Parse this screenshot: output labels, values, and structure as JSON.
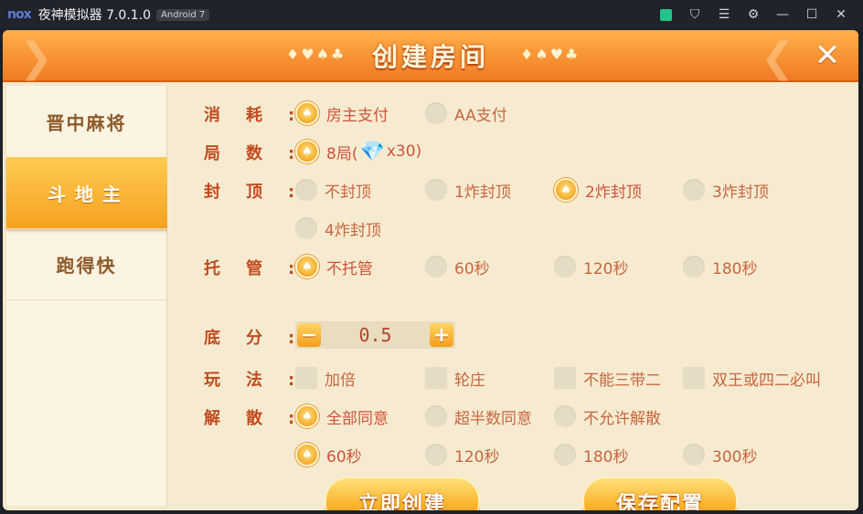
{
  "window": {
    "logo": "nox",
    "title": "夜神模拟器 7.0.1.0",
    "badge": "Android 7"
  },
  "header": {
    "title": "创建房间",
    "deco_left": "♦♥♠♣",
    "deco_right": "♦♠♥♣"
  },
  "sidebar": {
    "items": [
      {
        "label": "晋中麻将"
      },
      {
        "label": "斗地主"
      },
      {
        "label": "跑得快"
      }
    ]
  },
  "rows": {
    "consume": {
      "label": "消耗:",
      "options": [
        "房主支付",
        "AA支付"
      ]
    },
    "rounds": {
      "label": "局数:",
      "option_prefix": "8局(",
      "option_suffix": "x30)"
    },
    "cap": {
      "label": "封顶:",
      "options": [
        "不封顶",
        "1炸封顶",
        "2炸封顶",
        "3炸封顶",
        "4炸封顶"
      ]
    },
    "auto": {
      "label": "托管:",
      "options": [
        "不托管",
        "60秒",
        "120秒",
        "180秒"
      ]
    },
    "base": {
      "label": "底分:",
      "value": "0.5",
      "minus": "−",
      "plus": "+"
    },
    "play": {
      "label": "玩法:",
      "options": [
        "加倍",
        "轮庄",
        "不能三带二",
        "双王或四二必叫"
      ]
    },
    "dissolve": {
      "label": "解散:",
      "options": [
        "全部同意",
        "超半数同意",
        "不允许解散"
      ],
      "times": [
        "60秒",
        "120秒",
        "180秒",
        "300秒"
      ]
    }
  },
  "buttons": {
    "create": "立即创建",
    "save": "保存配置"
  },
  "colors": {
    "accent": "#f59d1d",
    "label": "#c14b1f",
    "option_text": "#d0533a"
  }
}
